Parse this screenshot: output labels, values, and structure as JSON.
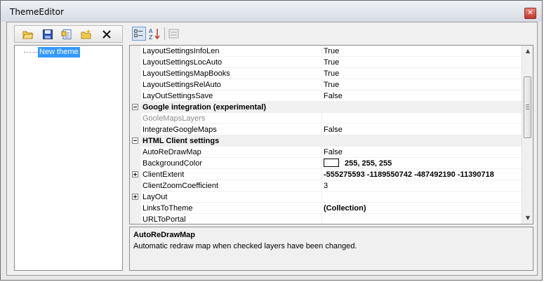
{
  "window": {
    "title": "ThemeEditor",
    "close_icon": "close-icon"
  },
  "left_toolbar": {
    "icons": [
      "open-folder-icon",
      "save-icon",
      "properties-icon",
      "new-folder-icon",
      "delete-icon"
    ]
  },
  "tree": {
    "nodes": [
      {
        "label": "New theme",
        "selected": true
      }
    ]
  },
  "right_toolbar": {
    "icons": [
      "categorized-icon",
      "sort-alphabetical-icon",
      "property-pages-icon"
    ]
  },
  "property_grid": {
    "rows": [
      {
        "type": "prop",
        "name": "LayoutSettingsInfoLen",
        "value": "True"
      },
      {
        "type": "prop",
        "name": "LayoutSettingsLocAuto",
        "value": "True"
      },
      {
        "type": "prop",
        "name": "LayoutSettingsMapBooks",
        "value": "True"
      },
      {
        "type": "prop",
        "name": "LayoutSettingsRelAuto",
        "value": "True"
      },
      {
        "type": "prop",
        "name": "LayOutSettingsSave",
        "value": "False"
      },
      {
        "type": "category",
        "name": "Google integration (experimental)"
      },
      {
        "type": "prop",
        "name": "GooleMapsLayers",
        "value": "",
        "disabled": true
      },
      {
        "type": "prop",
        "name": "IntegrateGoogleMaps",
        "value": "False"
      },
      {
        "type": "category",
        "name": "HTML Client settings"
      },
      {
        "type": "prop",
        "name": "AutoReDrawMap",
        "value": "False",
        "selected": true
      },
      {
        "type": "prop",
        "name": "BackgroundColor",
        "value": "255, 255, 255",
        "bold": true,
        "swatch": "#ffffff"
      },
      {
        "type": "prop",
        "name": "ClientExtent",
        "value": "-555275593 -1189550742 -487492190 -11390718",
        "bold": true,
        "expandable": true
      },
      {
        "type": "prop",
        "name": "ClientZoomCoefficient",
        "value": "3"
      },
      {
        "type": "prop",
        "name": "LayOut",
        "value": "",
        "expandable": true
      },
      {
        "type": "prop",
        "name": "LinksToTheme",
        "value": "(Collection)",
        "bold": true
      },
      {
        "type": "prop",
        "name": "URLToPortal",
        "value": ""
      }
    ]
  },
  "help": {
    "title": "AutoReDrawMap",
    "description": "Automatic redraw map when checked layers have been changed."
  }
}
